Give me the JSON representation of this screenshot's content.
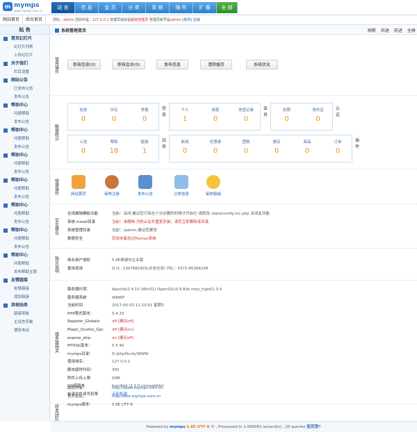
{
  "logo": {
    "name": "mymps",
    "url": "www.mymps.com.cn"
  },
  "nav": [
    {
      "label": "站 务"
    },
    {
      "label": "信 息"
    },
    {
      "label": "会 员"
    },
    {
      "label": "分 类"
    },
    {
      "label": "系 统"
    },
    {
      "label": "插 件"
    },
    {
      "label": "扩 展"
    },
    {
      "label": "全 部"
    }
  ],
  "infobar": {
    "quick": [
      "网站首页",
      "后台首页"
    ],
    "hello": "您好",
    "user": "admin",
    "ip_label": "您的IP是：",
    "ip": "127.0.0.1",
    "role_label": "管理员级别是",
    "role": "超级管理员",
    "acct_label": "管理员帐号是",
    "acct": "admin",
    "change": "[修改]",
    "logout": "注销"
  },
  "sidebar": {
    "title": "站 务",
    "groups": [
      {
        "label": "首页幻灯片",
        "items": [
          "幻灯片列表",
          "上传幻灯片"
        ]
      },
      {
        "label": "关于我们",
        "items": [
          "栏目设置"
        ]
      },
      {
        "label": "网站公告",
        "items": [
          "已发布公告",
          "发布公告"
        ]
      },
      {
        "label": "帮助中心",
        "items": [
          "问题帮助",
          "发布公告"
        ]
      },
      {
        "label": "帮助中心",
        "items": [
          "问题帮助",
          "发布公告"
        ]
      },
      {
        "label": "帮助中心",
        "items": [
          "问题帮助",
          "发布公告"
        ]
      },
      {
        "label": "帮助中心",
        "items": [
          "问题帮助",
          "发布公告"
        ]
      },
      {
        "label": "帮助中心",
        "items": [
          "问题帮助",
          "发布公告"
        ]
      },
      {
        "label": "帮助中心",
        "items": [
          "问题帮助",
          "发布公告"
        ]
      },
      {
        "label": "帮助中心",
        "items": [
          "问题帮助",
          "发布帮助主题"
        ]
      },
      {
        "label": "友情链接",
        "items": [
          "友情链接",
          "增加链接"
        ]
      },
      {
        "label": "其他站务",
        "items": [
          "链接导航",
          "主说言安装",
          "便民电话"
        ]
      }
    ]
  },
  "page": {
    "title": "系统管理首页",
    "ops": [
      "刷新",
      "后退",
      "前进",
      "全屏"
    ]
  },
  "common_ops": {
    "label": "常用操作",
    "buttons": [
      "审核信息(0)",
      "审核会员(0)",
      "发布信息",
      "清除缓存",
      "系统优化"
    ]
  },
  "stats": {
    "label": "数据统计",
    "row1": [
      {
        "label": "信息",
        "value": "0"
      },
      {
        "label": "评论",
        "value": "0"
      },
      {
        "label": "举报",
        "value": "0"
      }
    ],
    "row1_side": "信息",
    "row1b": [
      {
        "label": "个人",
        "value": "1"
      },
      {
        "label": "商家",
        "value": "0"
      },
      {
        "label": "充值记录",
        "value": "0"
      }
    ],
    "row1b_side": "会员",
    "row1c": [
      {
        "label": "执照",
        "value": "0"
      },
      {
        "label": "身份证",
        "value": "0"
      }
    ],
    "row1c_side": "认证",
    "row2": [
      {
        "label": "公告",
        "value": "0"
      },
      {
        "label": "帮助",
        "value": "18"
      },
      {
        "label": "链接",
        "value": "1"
      }
    ],
    "row2_side": "站务",
    "row2b": [
      {
        "label": "新闻",
        "value": "0"
      },
      {
        "label": "优惠券",
        "value": "0"
      },
      {
        "label": "团购",
        "value": "0"
      },
      {
        "label": "报名",
        "value": "0"
      },
      {
        "label": "商品",
        "value": "0"
      },
      {
        "label": "订单",
        "value": "0"
      }
    ],
    "row2b_side": "插件"
  },
  "quick": {
    "label": "快捷操作",
    "items": [
      {
        "label": "网站首页",
        "icon": "home-icon"
      },
      {
        "label": "审核注册",
        "icon": "user-icon"
      },
      {
        "label": "发布公告",
        "icon": "post-icon"
      },
      {
        "label": "分类信息",
        "icon": "search-icon"
      },
      {
        "label": "审核链接",
        "icon": "link-icon"
      }
    ]
  },
  "security": {
    "label": "安全建议",
    "items": [
      {
        "key": "在线编辑模板功能",
        "value": "当前：关闭·建议您只有在十分必要的时候才开启它·请修改 /data/config.inc.php 关闭此功能"
      },
      {
        "key": "系统 install目录",
        "value": "当前：未删除·为防止站长重复安装，请您立即删除该目录"
      },
      {
        "key": "系统管理目录",
        "value": "当前：/admin·建议您更改"
      },
      {
        "key": "数据安全",
        "value": "您尚未备份过Mymps系统"
      }
    ]
  },
  "purchase": {
    "label": "购买说明",
    "items": [
      {
        "key": "商业用户授权",
        "value": "5.8E单城市企业版"
      },
      {
        "key": "垂询咨询",
        "value": "Q Q：1307882925(点击交谈) TEL：0371-65366238"
      }
    ]
  },
  "server": {
    "label": "服务器相关",
    "items": [
      {
        "key": "服务器环境：",
        "value": "Apache/2.4.10 (Win32) OpenSSL/0.9.8zb mod_fcgid/2.3.9"
      },
      {
        "key": "服务器系统",
        "value": "WINNT"
      },
      {
        "key": "当前时间",
        "value": "2017-05-03 11:10:51 星期3"
      },
      {
        "key": "PHP程式版本：",
        "value": "5.4.33"
      },
      {
        "key": "Register_Globals:",
        "value": "off [建议off]"
      },
      {
        "key": "Magic_Quotes_Gpc",
        "value": "off [建议on]"
      },
      {
        "key": "expose_php:",
        "value": "on [建议off]"
      },
      {
        "key": "MYSQL版本：",
        "value": "5.5.40"
      },
      {
        "key": "mymps目录：",
        "value": "D:/phpStudy/WWW"
      },
      {
        "key": "使用域名：",
        "value": "127.0.0.1"
      },
      {
        "key": "脚本超时时间：",
        "value": "300"
      },
      {
        "key": "附件上传上限",
        "value": "50M"
      },
      {
        "key": "GD库版本",
        "value": "bundled (2.1.0 compatible)"
      },
      {
        "key": "检测文件读写权限",
        "value": "点此检测"
      }
    ]
  },
  "team": {
    "label": "研发团队",
    "items": [
      {
        "key": "版权所有：",
        "value": "http://www.mymps.com.cn"
      },
      {
        "key": "官方论坛：",
        "value": "http://bbs.mymps.com.cn"
      },
      {
        "key": "mymps版本：",
        "value": "5.8E UTF-8"
      }
    ]
  },
  "footer": {
    "powered": "Powered by",
    "brand": "mymps",
    "version": "5.8E UTF-8",
    "rest": "© , Processed in 1.060061 second(s) , 20 queries",
    "top": "至页顶↑"
  },
  "colors": {
    "accent": "#2d7fcb",
    "number": "#f09020",
    "link": "#1a5fb4",
    "danger": "#d0312d"
  }
}
